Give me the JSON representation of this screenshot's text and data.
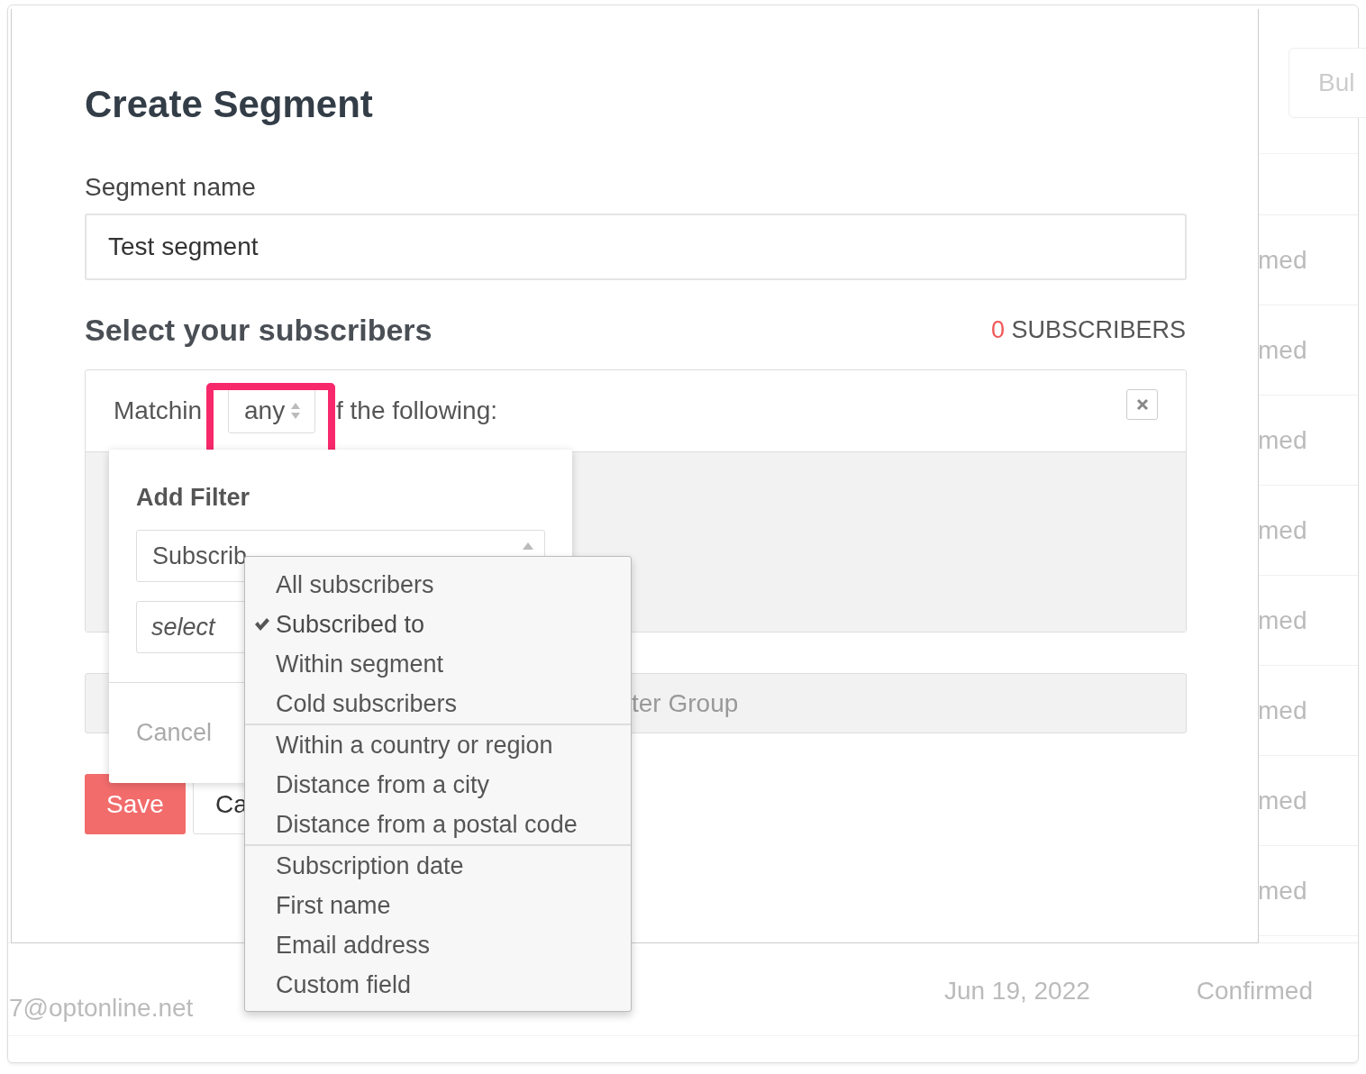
{
  "background": {
    "bulk_button": "Bul",
    "status_cells": [
      "med",
      "med",
      "med",
      "med",
      "med",
      "med",
      "med",
      "med"
    ],
    "row": {
      "email": "7@optonline.net",
      "date": "Jun 19, 2022",
      "status": "Confirmed"
    }
  },
  "modal": {
    "title": "Create Segment",
    "name_label": "Segment name",
    "name_value": "Test segment",
    "section_title": "Select your subscribers",
    "subscriber_count": "0",
    "subscriber_label": "SUBSCRIBERS",
    "matching": {
      "prefix": "Matchin",
      "mode": "any",
      "suffix": "f the following:",
      "highlighted": true
    },
    "group_field": "ter Group",
    "save": "Save",
    "cancel": "Ca"
  },
  "add_filter": {
    "title": "Add Filter",
    "type_value": "Subscrib",
    "placeholder": "select",
    "cancel": "Cancel"
  },
  "filter_menu": {
    "groups": [
      [
        {
          "label": "All subscribers",
          "selected": false
        },
        {
          "label": "Subscribed to",
          "selected": true
        },
        {
          "label": "Within segment",
          "selected": false
        },
        {
          "label": "Cold subscribers",
          "selected": false
        }
      ],
      [
        {
          "label": "Within a country or region",
          "selected": false
        },
        {
          "label": "Distance from a city",
          "selected": false
        },
        {
          "label": "Distance from a postal code",
          "selected": false
        }
      ],
      [
        {
          "label": "Subscription date",
          "selected": false
        },
        {
          "label": "First name",
          "selected": false
        },
        {
          "label": "Email address",
          "selected": false
        },
        {
          "label": "Custom field",
          "selected": false
        }
      ]
    ]
  }
}
